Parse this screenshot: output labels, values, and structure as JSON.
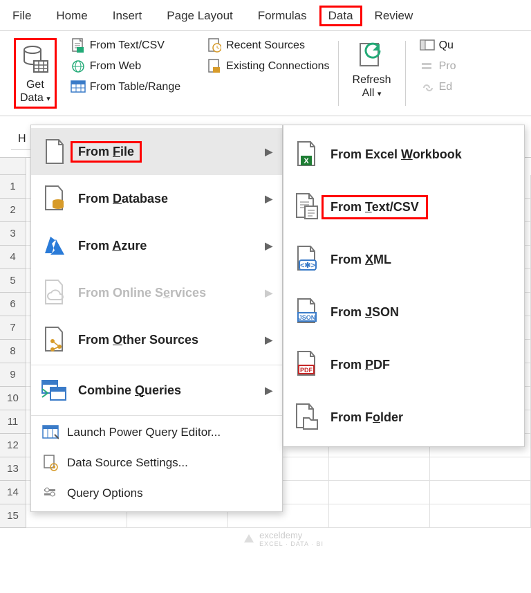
{
  "tabs": {
    "file": "File",
    "home": "Home",
    "insert": "Insert",
    "page_layout": "Page Layout",
    "formulas": "Formulas",
    "data": "Data",
    "review": "Review"
  },
  "ribbon": {
    "get_data": {
      "line1": "Get",
      "line2": "Data"
    },
    "from_text_csv": "From Text/CSV",
    "from_web": "From Web",
    "from_table_range": "From Table/Range",
    "recent_sources": "Recent Sources",
    "existing_connections": "Existing Connections",
    "refresh_all": {
      "line1": "Refresh",
      "line2": "All"
    },
    "qu": "Qu",
    "pro": "Pro",
    "ed": "Ed"
  },
  "name_box": "H",
  "menu1": {
    "from_file": "From File",
    "from_database": "From Database",
    "from_azure": "From Azure",
    "from_online": "From Online Services",
    "from_other": "From Other Sources",
    "combine": "Combine Queries",
    "launch_pq": "Launch Power Query Editor...",
    "ds_settings": "Data Source Settings...",
    "query_options": "Query Options"
  },
  "menu2": {
    "excel_wb": "From Excel Workbook",
    "text_csv": "From Text/CSV",
    "xml": "From XML",
    "json": "From JSON",
    "pdf": "From PDF",
    "folder": "From Folder"
  },
  "grid": {
    "rows": [
      "1",
      "2",
      "3",
      "4",
      "5",
      "6",
      "7",
      "8",
      "9",
      "10",
      "11",
      "12",
      "13",
      "14",
      "15"
    ]
  },
  "watermark": {
    "name": "exceldemy",
    "sub": "EXCEL · DATA · BI"
  }
}
